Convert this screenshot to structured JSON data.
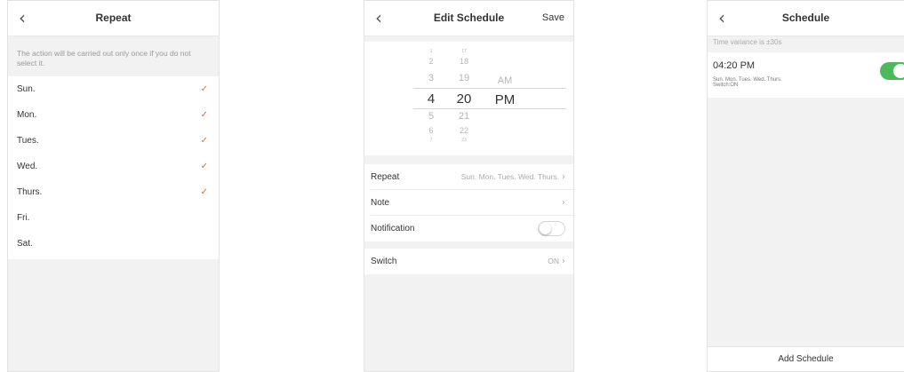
{
  "repeat_screen": {
    "title": "Repeat",
    "info": "The action will be carried out only once if you do not select it.",
    "days": [
      {
        "label": "Sun.",
        "checked": true
      },
      {
        "label": "Mon.",
        "checked": true
      },
      {
        "label": "Tues.",
        "checked": true
      },
      {
        "label": "Wed.",
        "checked": true
      },
      {
        "label": "Thurs.",
        "checked": true
      },
      {
        "label": "Fri.",
        "checked": false
      },
      {
        "label": "Sat.",
        "checked": false
      }
    ],
    "check_glyph": "✓",
    "check_color": "#e8682e"
  },
  "edit_screen": {
    "title": "Edit Schedule",
    "save_label": "Save",
    "picker": {
      "hours": [
        "1",
        "2",
        "3",
        "4",
        "5",
        "6",
        "7"
      ],
      "minutes": [
        "17",
        "18",
        "19",
        "20",
        "21",
        "22",
        "23"
      ],
      "ampm": [
        "AM",
        "PM"
      ],
      "selected_hour": "4",
      "selected_minute": "20",
      "selected_ampm": "PM"
    },
    "rows": {
      "repeat": {
        "label": "Repeat",
        "value": "Sun. Mon. Tues. Wed. Thurs."
      },
      "note": {
        "label": "Note",
        "value": ""
      },
      "notification": {
        "label": "Notification",
        "toggle": false
      },
      "switch": {
        "label": "Switch",
        "value": "ON"
      }
    }
  },
  "schedule_screen": {
    "title": "Schedule",
    "variance": "Time variance is ±30s",
    "item": {
      "time": "04:20 PM",
      "days": "Sun. Mon. Tues. Wed. Thurs.",
      "switch": "Switch:ON",
      "enabled": true
    },
    "add_label": "Add Schedule",
    "toggle_color": "#4cba5c"
  },
  "icons": {
    "back": "‹",
    "chevron": "›"
  }
}
